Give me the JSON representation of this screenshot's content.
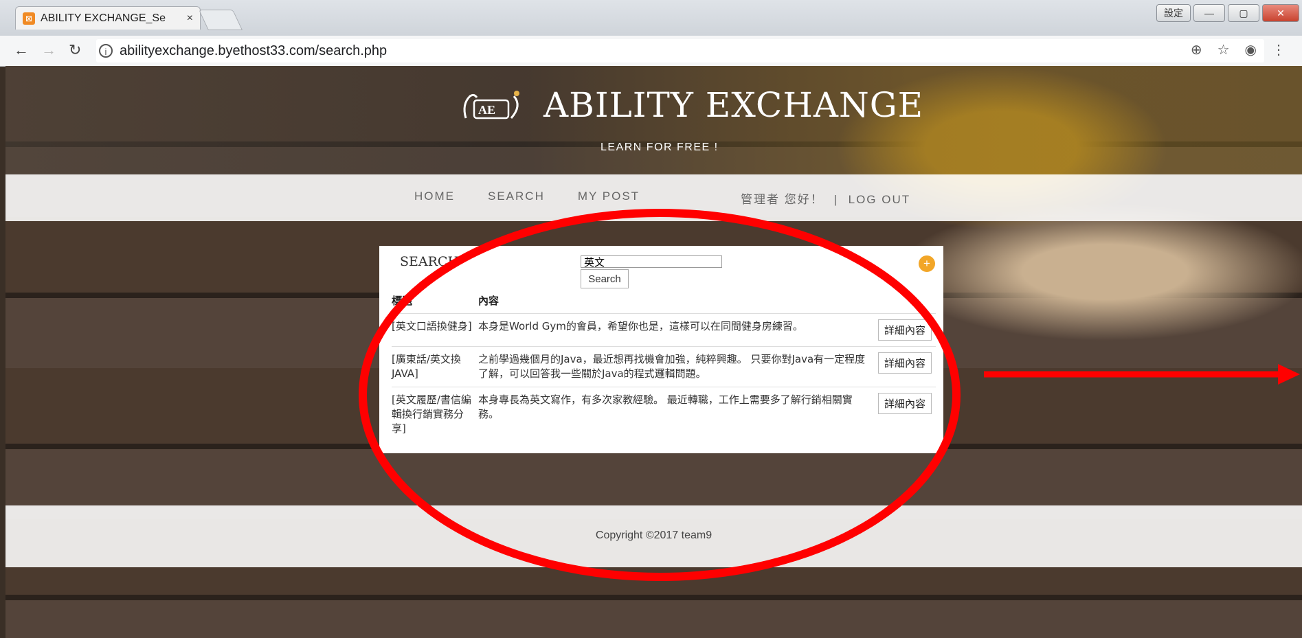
{
  "browser": {
    "tab_title": "ABILITY EXCHANGE_Se",
    "tab_close": "×",
    "lang_button": "設定",
    "url": "abilityexchange.byethost33.com/search.php"
  },
  "header": {
    "brand": "ABILITY EXCHANGE",
    "tagline": "LEARN FOR FREE !"
  },
  "nav": {
    "home": "HOME",
    "search": "SEARCH",
    "my_post": "MY POST",
    "greeting": "管理者 您好！",
    "separator": "|",
    "logout": "LOG OUT"
  },
  "search": {
    "title": "SEARCH",
    "query": "英文",
    "button": "Search",
    "plus": "+"
  },
  "results": {
    "col_title": "標題",
    "col_content": "內容",
    "detail_label": "詳細內容",
    "rows": [
      {
        "title": "[英文口語換健身]",
        "content": "本身是World Gym的會員，希望你也是，這樣可以在同間健身房練習。"
      },
      {
        "title": "[廣東話/英文換JAVA]",
        "content": "之前學過幾個月的Java，最近想再找機會加強，純粹興趣。 只要你對Java有一定程度了解，可以回答我一些關於Java的程式邏輯問題。"
      },
      {
        "title": "[英文履歷/書信編輯換行銷實務分享]",
        "content": "本身專長為英文寫作，有多次家教經驗。 最近轉職，工作上需要多了解行銷相關實務。"
      }
    ]
  },
  "footer": {
    "copyright": "Copyright ©2017 team9"
  },
  "annotation": {
    "color": "#ff0000"
  }
}
